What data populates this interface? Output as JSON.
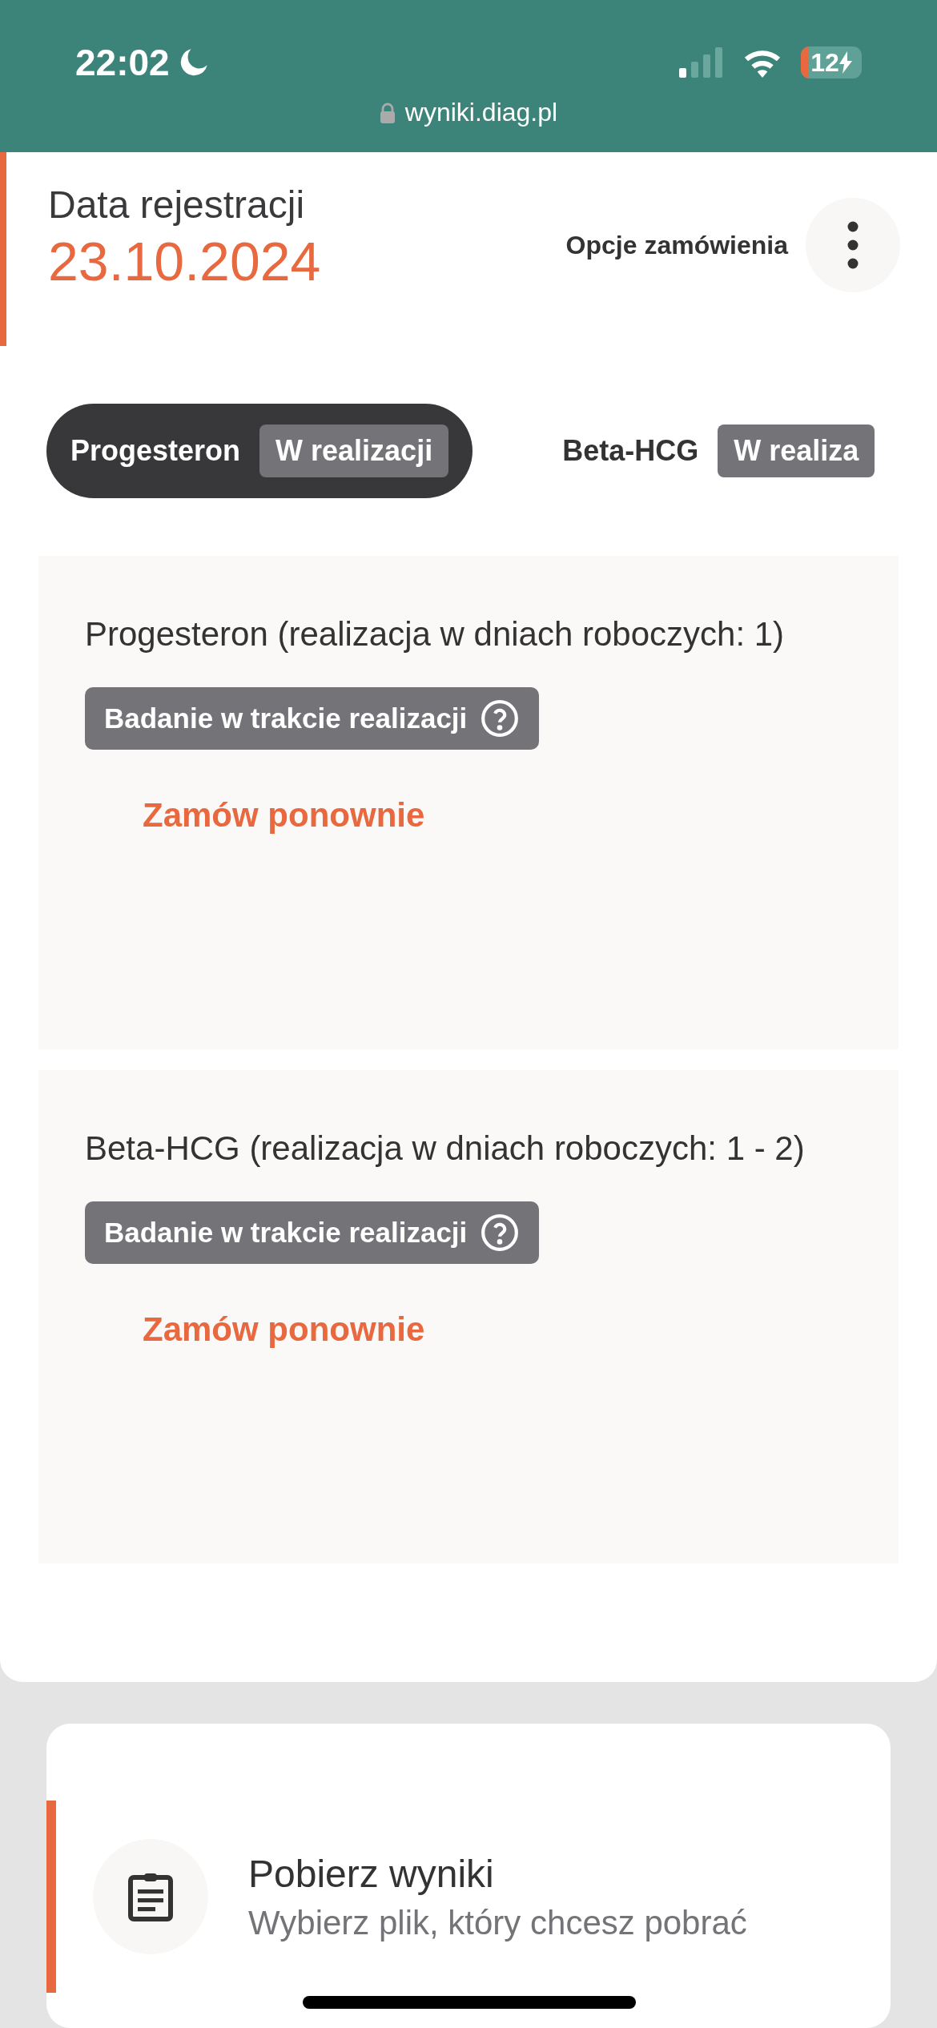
{
  "status_bar": {
    "time": "22:02",
    "battery": "12",
    "url": "wyniki.diag.pl"
  },
  "header": {
    "label": "Data rejestracji",
    "date": "23.10.2024",
    "options_label": "Opcje zamówienia"
  },
  "tabs": [
    {
      "name": "Progesteron",
      "badge": "W realizacji",
      "selected": true
    },
    {
      "name": "Beta-HCG",
      "badge": "W realiza",
      "selected": false
    }
  ],
  "tests": [
    {
      "title": "Progesteron (realizacja w dniach roboczych: 1)",
      "status": "Badanie w trakcie realizacji",
      "action": "Zamów ponownie"
    },
    {
      "title": "Beta-HCG (realizacja w dniach roboczych: 1 - 2)",
      "status": "Badanie w trakcie realizacji",
      "action": "Zamów ponownie"
    }
  ],
  "download": {
    "title": "Pobierz wyniki",
    "subtitle": "Wybierz plik, który chcesz pobrać"
  }
}
